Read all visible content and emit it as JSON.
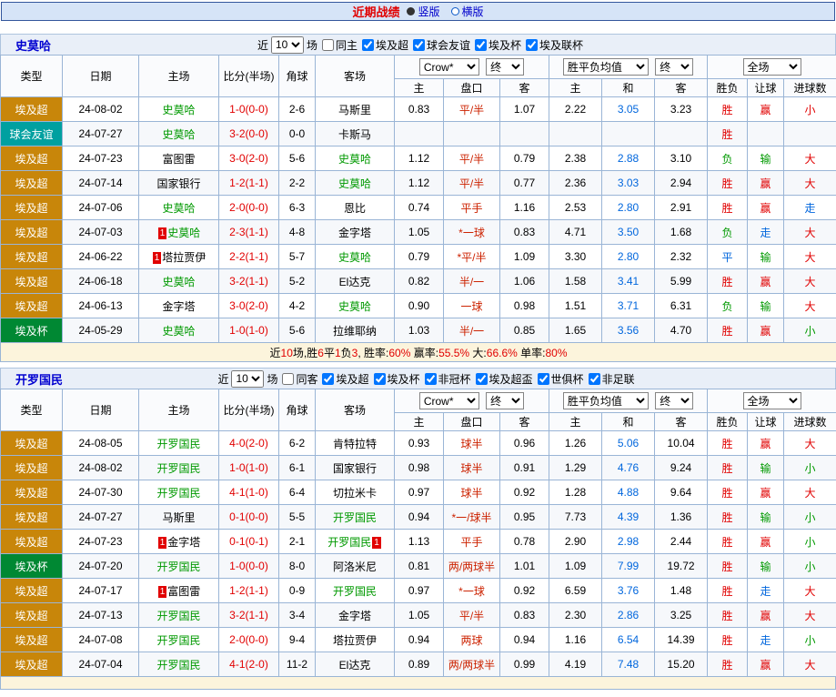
{
  "topbar": {
    "title": "近期战绩",
    "vertical_label": "竖版",
    "horizontal_label": "横版"
  },
  "table_header": {
    "type": "类型",
    "date": "日期",
    "home": "主场",
    "score": "比分(半场)",
    "corner": "角球",
    "away": "客场",
    "bookmaker": "Crow*",
    "final": "终",
    "avg": "胜平负均值",
    "full": "全场",
    "home_odds": "主",
    "handicap": "盘口",
    "away_odds": "客",
    "draw": "和",
    "result": "胜负",
    "handicap_result": "让球",
    "goals": "进球数"
  },
  "league_colors": {
    "埃及超": "#c8860a",
    "球会友谊": "#00a0a0",
    "埃及杯": "#008833"
  },
  "value_colors": {
    "r": "#e10000",
    "g": "#009900",
    "b": "#0066dd",
    "k": "#000000"
  },
  "sections": [
    {
      "team": "史莫哈",
      "filters": {
        "near": "近",
        "count": "10",
        "unit": "场",
        "same": {
          "label": "同主",
          "checked": false
        },
        "leagues": [
          {
            "label": "埃及超",
            "checked": true
          },
          {
            "label": "球会友谊",
            "checked": true
          },
          {
            "label": "埃及杯",
            "checked": true
          },
          {
            "label": "埃及联杯",
            "checked": true
          }
        ]
      },
      "rows": [
        {
          "league": "埃及超",
          "date": "24-08-02",
          "home": {
            "n": "史莫哈",
            "f": true
          },
          "score": "1-0(0-0)",
          "corner": "2-6",
          "away": {
            "n": "马斯里"
          },
          "odds": [
            "0.83",
            "平/半",
            "1.07"
          ],
          "avg": [
            "2.22",
            "3.05",
            "3.23"
          ],
          "res": {
            "t": "胜",
            "c": "r"
          },
          "let": {
            "t": "赢",
            "c": "r"
          },
          "goal": {
            "t": "小",
            "c": "r"
          }
        },
        {
          "league": "球会友谊",
          "date": "24-07-27",
          "home": {
            "n": "史莫哈",
            "f": true
          },
          "score": "3-2(0-0)",
          "corner": "0-0",
          "away": {
            "n": "卡斯马"
          },
          "odds": [
            "",
            "",
            ""
          ],
          "avg": [
            "",
            "",
            ""
          ],
          "res": {
            "t": "胜",
            "c": "r"
          },
          "let": {
            "t": "",
            "c": "k"
          },
          "goal": {
            "t": "",
            "c": "k"
          }
        },
        {
          "league": "埃及超",
          "date": "24-07-23",
          "home": {
            "n": "富图雷"
          },
          "score": "3-0(2-0)",
          "corner": "5-6",
          "away": {
            "n": "史莫哈",
            "f": true
          },
          "odds": [
            "1.12",
            "平/半",
            "0.79"
          ],
          "avg": [
            "2.38",
            "2.88",
            "3.10"
          ],
          "res": {
            "t": "负",
            "c": "g"
          },
          "let": {
            "t": "输",
            "c": "g"
          },
          "goal": {
            "t": "大",
            "c": "r"
          }
        },
        {
          "league": "埃及超",
          "date": "24-07-14",
          "home": {
            "n": "国家银行"
          },
          "score": "1-2(1-1)",
          "corner": "2-2",
          "away": {
            "n": "史莫哈",
            "f": true
          },
          "odds": [
            "1.12",
            "平/半",
            "0.77"
          ],
          "avg": [
            "2.36",
            "3.03",
            "2.94"
          ],
          "res": {
            "t": "胜",
            "c": "r"
          },
          "let": {
            "t": "赢",
            "c": "r"
          },
          "goal": {
            "t": "大",
            "c": "r"
          }
        },
        {
          "league": "埃及超",
          "date": "24-07-06",
          "home": {
            "n": "史莫哈",
            "f": true
          },
          "score": "2-0(0-0)",
          "corner": "6-3",
          "away": {
            "n": "恩比"
          },
          "odds": [
            "0.74",
            "平手",
            "1.16"
          ],
          "avg": [
            "2.53",
            "2.80",
            "2.91"
          ],
          "res": {
            "t": "胜",
            "c": "r"
          },
          "let": {
            "t": "赢",
            "c": "r"
          },
          "goal": {
            "t": "走",
            "c": "b"
          }
        },
        {
          "league": "埃及超",
          "date": "24-07-03",
          "home": {
            "n": "史莫哈",
            "f": true,
            "rb": "1"
          },
          "score": "2-3(1-1)",
          "corner": "4-8",
          "away": {
            "n": "金字塔"
          },
          "odds": [
            "1.05",
            "*一球",
            "0.83"
          ],
          "avg": [
            "4.71",
            "3.50",
            "1.68"
          ],
          "res": {
            "t": "负",
            "c": "g"
          },
          "let": {
            "t": "走",
            "c": "b"
          },
          "goal": {
            "t": "大",
            "c": "r"
          }
        },
        {
          "league": "埃及超",
          "date": "24-06-22",
          "home": {
            "n": "塔拉贾伊",
            "rb": "1"
          },
          "score": "2-2(1-1)",
          "corner": "5-7",
          "away": {
            "n": "史莫哈",
            "f": true
          },
          "odds": [
            "0.79",
            "*平/半",
            "1.09"
          ],
          "avg": [
            "3.30",
            "2.80",
            "2.32"
          ],
          "res": {
            "t": "平",
            "c": "b"
          },
          "let": {
            "t": "输",
            "c": "g"
          },
          "goal": {
            "t": "大",
            "c": "r"
          }
        },
        {
          "league": "埃及超",
          "date": "24-06-18",
          "home": {
            "n": "史莫哈",
            "f": true
          },
          "score": "3-2(1-1)",
          "corner": "5-2",
          "away": {
            "n": "El达克"
          },
          "odds": [
            "0.82",
            "半/一",
            "1.06"
          ],
          "avg": [
            "1.58",
            "3.41",
            "5.99"
          ],
          "res": {
            "t": "胜",
            "c": "r"
          },
          "let": {
            "t": "赢",
            "c": "r"
          },
          "goal": {
            "t": "大",
            "c": "r"
          }
        },
        {
          "league": "埃及超",
          "date": "24-06-13",
          "home": {
            "n": "金字塔"
          },
          "score": "3-0(2-0)",
          "corner": "4-2",
          "away": {
            "n": "史莫哈",
            "f": true
          },
          "odds": [
            "0.90",
            "一球",
            "0.98"
          ],
          "avg": [
            "1.51",
            "3.71",
            "6.31"
          ],
          "res": {
            "t": "负",
            "c": "g"
          },
          "let": {
            "t": "输",
            "c": "g"
          },
          "goal": {
            "t": "大",
            "c": "r"
          }
        },
        {
          "league": "埃及杯",
          "date": "24-05-29",
          "home": {
            "n": "史莫哈",
            "f": true
          },
          "score": "1-0(1-0)",
          "corner": "5-6",
          "away": {
            "n": "拉维耶纳"
          },
          "odds": [
            "1.03",
            "半/一",
            "0.85"
          ],
          "avg": [
            "1.65",
            "3.56",
            "4.70"
          ],
          "res": {
            "t": "胜",
            "c": "r"
          },
          "let": {
            "t": "赢",
            "c": "r"
          },
          "goal": {
            "t": "小",
            "c": "g"
          }
        }
      ],
      "summary": [
        {
          "t": "近"
        },
        {
          "t": "10",
          "c": "r"
        },
        {
          "t": "场,胜"
        },
        {
          "t": "6",
          "c": "r"
        },
        {
          "t": "平"
        },
        {
          "t": "1",
          "c": "r"
        },
        {
          "t": "负"
        },
        {
          "t": "3",
          "c": "r"
        },
        {
          "t": ", 胜率:"
        },
        {
          "t": "60%",
          "c": "r"
        },
        {
          "t": " 赢率:"
        },
        {
          "t": "55.5%",
          "c": "r"
        },
        {
          "t": " 大:"
        },
        {
          "t": "66.6%",
          "c": "r"
        },
        {
          "t": " 单率:"
        },
        {
          "t": "80%",
          "c": "r"
        }
      ]
    },
    {
      "team": "开罗国民",
      "filters": {
        "near": "近",
        "count": "10",
        "unit": "场",
        "same": {
          "label": "同客",
          "checked": false
        },
        "leagues": [
          {
            "label": "埃及超",
            "checked": true
          },
          {
            "label": "埃及杯",
            "checked": true
          },
          {
            "label": "非冠杯",
            "checked": true
          },
          {
            "label": "埃及超盃",
            "checked": true
          },
          {
            "label": "世俱杯",
            "checked": true
          },
          {
            "label": "非足联",
            "checked": true
          }
        ]
      },
      "rows": [
        {
          "league": "埃及超",
          "date": "24-08-05",
          "home": {
            "n": "开罗国民",
            "f": true
          },
          "score": "4-0(2-0)",
          "corner": "6-2",
          "away": {
            "n": "肯特拉特"
          },
          "odds": [
            "0.93",
            "球半",
            "0.96"
          ],
          "avg": [
            "1.26",
            "5.06",
            "10.04"
          ],
          "res": {
            "t": "胜",
            "c": "r"
          },
          "let": {
            "t": "赢",
            "c": "r"
          },
          "goal": {
            "t": "大",
            "c": "r"
          }
        },
        {
          "league": "埃及超",
          "date": "24-08-02",
          "home": {
            "n": "开罗国民",
            "f": true
          },
          "score": "1-0(1-0)",
          "corner": "6-1",
          "away": {
            "n": "国家银行"
          },
          "odds": [
            "0.98",
            "球半",
            "0.91"
          ],
          "avg": [
            "1.29",
            "4.76",
            "9.24"
          ],
          "res": {
            "t": "胜",
            "c": "r"
          },
          "let": {
            "t": "输",
            "c": "g"
          },
          "goal": {
            "t": "小",
            "c": "g"
          }
        },
        {
          "league": "埃及超",
          "date": "24-07-30",
          "home": {
            "n": "开罗国民",
            "f": true
          },
          "score": "4-1(1-0)",
          "corner": "6-4",
          "away": {
            "n": "切拉米卡"
          },
          "odds": [
            "0.97",
            "球半",
            "0.92"
          ],
          "avg": [
            "1.28",
            "4.88",
            "9.64"
          ],
          "res": {
            "t": "胜",
            "c": "r"
          },
          "let": {
            "t": "赢",
            "c": "r"
          },
          "goal": {
            "t": "大",
            "c": "r"
          }
        },
        {
          "league": "埃及超",
          "date": "24-07-27",
          "home": {
            "n": "马斯里"
          },
          "score": "0-1(0-0)",
          "corner": "5-5",
          "away": {
            "n": "开罗国民",
            "f": true
          },
          "odds": [
            "0.94",
            "*一/球半",
            "0.95"
          ],
          "avg": [
            "7.73",
            "4.39",
            "1.36"
          ],
          "res": {
            "t": "胜",
            "c": "r"
          },
          "let": {
            "t": "输",
            "c": "g"
          },
          "goal": {
            "t": "小",
            "c": "g"
          }
        },
        {
          "league": "埃及超",
          "date": "24-07-23",
          "home": {
            "n": "金字塔",
            "rb": "1"
          },
          "score": "0-1(0-1)",
          "corner": "2-1",
          "away": {
            "n": "开罗国民",
            "f": true,
            "ra": "1"
          },
          "odds": [
            "1.13",
            "平手",
            "0.78"
          ],
          "avg": [
            "2.90",
            "2.98",
            "2.44"
          ],
          "res": {
            "t": "胜",
            "c": "r"
          },
          "let": {
            "t": "赢",
            "c": "r"
          },
          "goal": {
            "t": "小",
            "c": "g"
          }
        },
        {
          "league": "埃及杯",
          "date": "24-07-20",
          "home": {
            "n": "开罗国民",
            "f": true
          },
          "score": "1-0(0-0)",
          "corner": "8-0",
          "away": {
            "n": "阿洛米尼"
          },
          "odds": [
            "0.81",
            "两/两球半",
            "1.01"
          ],
          "avg": [
            "1.09",
            "7.99",
            "19.72"
          ],
          "res": {
            "t": "胜",
            "c": "r"
          },
          "let": {
            "t": "输",
            "c": "g"
          },
          "goal": {
            "t": "小",
            "c": "g"
          }
        },
        {
          "league": "埃及超",
          "date": "24-07-17",
          "home": {
            "n": "富图雷",
            "rb": "1"
          },
          "score": "1-2(1-1)",
          "corner": "0-9",
          "away": {
            "n": "开罗国民",
            "f": true
          },
          "odds": [
            "0.97",
            "*一球",
            "0.92"
          ],
          "avg": [
            "6.59",
            "3.76",
            "1.48"
          ],
          "res": {
            "t": "胜",
            "c": "r"
          },
          "let": {
            "t": "走",
            "c": "b"
          },
          "goal": {
            "t": "大",
            "c": "r"
          }
        },
        {
          "league": "埃及超",
          "date": "24-07-13",
          "home": {
            "n": "开罗国民",
            "f": true
          },
          "score": "3-2(1-1)",
          "corner": "3-4",
          "away": {
            "n": "金字塔"
          },
          "odds": [
            "1.05",
            "平/半",
            "0.83"
          ],
          "avg": [
            "2.30",
            "2.86",
            "3.25"
          ],
          "res": {
            "t": "胜",
            "c": "r"
          },
          "let": {
            "t": "赢",
            "c": "r"
          },
          "goal": {
            "t": "大",
            "c": "r"
          }
        },
        {
          "league": "埃及超",
          "date": "24-07-08",
          "home": {
            "n": "开罗国民",
            "f": true
          },
          "score": "2-0(0-0)",
          "corner": "9-4",
          "away": {
            "n": "塔拉贾伊"
          },
          "odds": [
            "0.94",
            "两球",
            "0.94"
          ],
          "avg": [
            "1.16",
            "6.54",
            "14.39"
          ],
          "res": {
            "t": "胜",
            "c": "r"
          },
          "let": {
            "t": "走",
            "c": "b"
          },
          "goal": {
            "t": "小",
            "c": "g"
          }
        },
        {
          "league": "埃及超",
          "date": "24-07-04",
          "home": {
            "n": "开罗国民",
            "f": true
          },
          "score": "4-1(2-0)",
          "corner": "11-2",
          "away": {
            "n": "El达克"
          },
          "odds": [
            "0.89",
            "两/两球半",
            "0.99"
          ],
          "avg": [
            "4.19",
            "7.48",
            "15.20"
          ],
          "res": {
            "t": "胜",
            "c": "r"
          },
          "let": {
            "t": "赢",
            "c": "r"
          },
          "goal": {
            "t": "大",
            "c": "r"
          }
        }
      ]
    }
  ]
}
